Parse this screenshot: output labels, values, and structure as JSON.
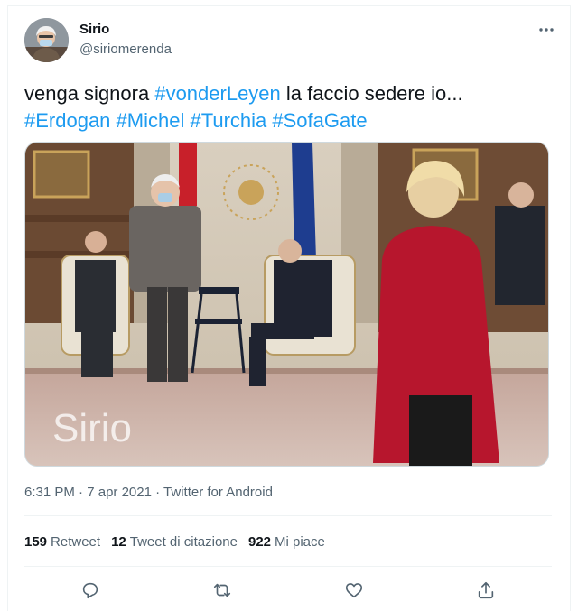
{
  "user": {
    "display_name": "Sirio",
    "handle": "@siriomerenda"
  },
  "tweet": {
    "text_parts": [
      {
        "text": "venga signora ",
        "hashtag": false
      },
      {
        "text": "#vonderLeyen",
        "hashtag": true
      },
      {
        "text": " la faccio sedere io...",
        "hashtag": false
      },
      {
        "text": "#Erdogan",
        "hashtag": true
      },
      {
        "text": "#Michel",
        "hashtag": true
      },
      {
        "text": "#Turchia",
        "hashtag": true
      },
      {
        "text": "#SofaGate",
        "hashtag": true
      }
    ],
    "watermark": "Sirio"
  },
  "meta": {
    "time": "6:31 PM",
    "date": "7 apr 2021",
    "source": "Twitter for Android",
    "separator": "·"
  },
  "stats": {
    "retweets_count": "159",
    "retweets_label": "Retweet",
    "quotes_count": "12",
    "quotes_label": "Tweet di citazione",
    "likes_count": "922",
    "likes_label": "Mi piace"
  },
  "icons": {
    "more": "more-icon",
    "reply": "reply-icon",
    "retweet": "retweet-icon",
    "like": "like-icon",
    "share": "share-icon"
  },
  "colors": {
    "hashtag": "#1d9bf0",
    "secondary_text": "#536471",
    "icon": "#536471"
  }
}
